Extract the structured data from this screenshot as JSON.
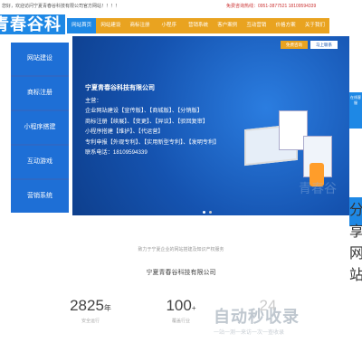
{
  "topbar": {
    "welcome": "您好，欢迎访问宁夏青春谷科技有限公司官方网站！！！！",
    "phone": "免费咨询热线：0951-3877521    18109594339"
  },
  "logo": {
    "text": "青春谷科技"
  },
  "nav": [
    {
      "label": "网站首页",
      "active": true
    },
    {
      "label": "网站建设"
    },
    {
      "label": "商标注册"
    },
    {
      "label": "小程序"
    },
    {
      "label": "营销系统"
    },
    {
      "label": "客户案例"
    },
    {
      "label": "互动营销"
    },
    {
      "label": "价格方案"
    },
    {
      "label": "关于我们"
    }
  ],
  "sidebar": [
    {
      "label": "网站建设"
    },
    {
      "label": "商标注册"
    },
    {
      "label": "小程序搭建"
    },
    {
      "label": "互动游戏"
    },
    {
      "label": "营销系统"
    }
  ],
  "hero": {
    "tag_a": "免费咨询",
    "tag_b": "马上联系",
    "title": "宁夏青春谷科技有限公司",
    "lines": [
      "主营：",
      "企业网站建设【宣传版】、【商城版】、【分销版】",
      "商标注册【续展】、【变更】、【异议】、【驳回复审】",
      "小程序搭建【维护】、【代运营】",
      "专利申报【外观专利】、【实用新型专利】、【发明专利】",
      "联系电话：18109594339"
    ],
    "logo_mark": "青春谷"
  },
  "side_widgets": {
    "top": "在线客服",
    "bottom": "分享网站"
  },
  "tagline": "致力于宁夏企业的网站搭建及知识产权服务",
  "company_name": "宁夏青春谷科技有限公司",
  "stats": [
    {
      "num": "2825",
      "unit": "年",
      "label": "安全运行"
    },
    {
      "num": "100",
      "unit": "+",
      "label": "覆盖行业"
    },
    {
      "num": "24",
      "unit": "",
      "label": ""
    }
  ],
  "watermark": {
    "brand": "自动秒收录",
    "slogan": "一站一测一来访一次一查收录"
  },
  "colors": {
    "primary": "#1e88e5",
    "nav_orange": "#e9a320",
    "hero_blue": "#1553b0"
  }
}
